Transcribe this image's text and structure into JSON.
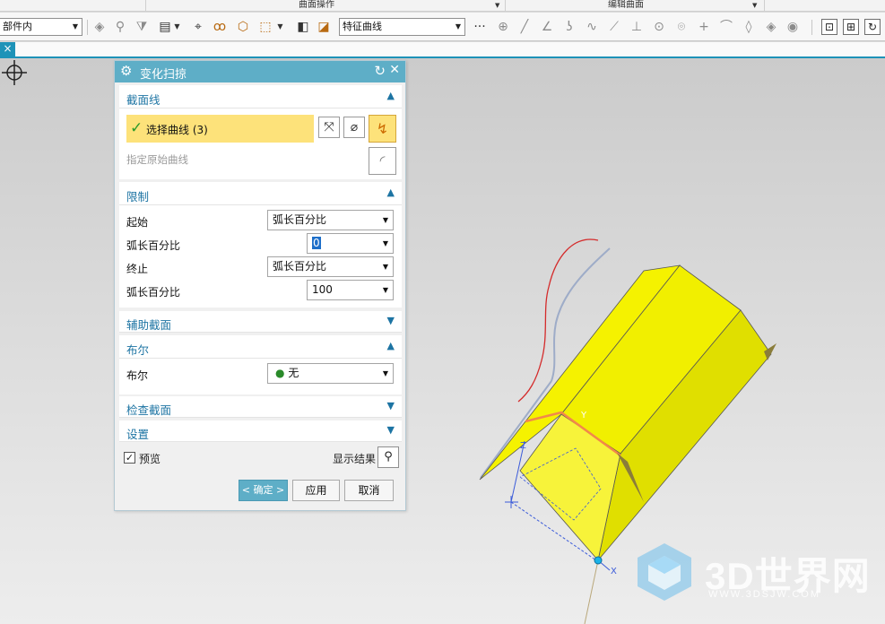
{
  "ribbon_groups": {
    "surface_ops": "曲面操作",
    "edit_surface": "编辑曲面"
  },
  "toolbar": {
    "filter_value": "部件内",
    "curve_rule_value": "特征曲线",
    "more": "···"
  },
  "tab": {
    "close_glyph": "×"
  },
  "dialog": {
    "title": "变化扫掠",
    "section_curve": {
      "label": "截面线",
      "select_curve": "选择曲线 (3)",
      "specify_original": "指定原始曲线"
    },
    "section_limits": {
      "label": "限制",
      "start_label": "起始",
      "start_value": "弧长百分比",
      "start_percent_label": "弧长百分比",
      "start_percent_value": "0",
      "end_label": "终止",
      "end_value": "弧长百分比",
      "end_percent_label": "弧长百分比",
      "end_percent_value": "100"
    },
    "section_aux": {
      "label": "辅助截面"
    },
    "section_boolean": {
      "label": "布尔",
      "boolean_label": "布尔",
      "boolean_value": "无"
    },
    "section_check": {
      "label": "检查截面"
    },
    "section_settings": {
      "label": "设置"
    },
    "preview_label": "预览",
    "preview_checked": true,
    "show_result_label": "显示结果",
    "ok_label": "< 确定 >",
    "apply_label": "应用",
    "cancel_label": "取消"
  },
  "viewport": {
    "axis_labels": {
      "y": "Y",
      "z": "Z",
      "x": "X"
    },
    "model_color": "#f5f200",
    "watermark_brand": "3D世界网",
    "watermark_url": "WWW.3DSJW.COM"
  },
  "colors": {
    "accent": "#5eaec7",
    "section_label": "#1d74a3",
    "selection_highlight": "#fde27a"
  }
}
